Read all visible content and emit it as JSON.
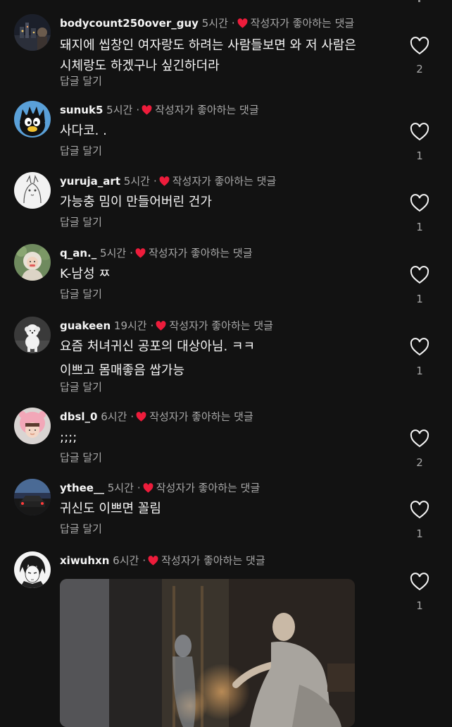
{
  "labels": {
    "liked_by_author": "작성자가 좋아하는 댓글",
    "reply": "답글 달기",
    "separator": "·"
  },
  "colors": {
    "background": "#121212",
    "heart_red": "#ed1c3b",
    "muted_text": "#a8a8a8"
  },
  "comments": [
    {
      "username": "bodycount250over_guy",
      "time": "5시간",
      "text": "돼지에 씹창인 여자랑도 하려는 사람들보면 와 저 사람은 시체랑도 하겠구나 싶긴하더라",
      "likes": "2",
      "avatar": "night-city-avatar"
    },
    {
      "username": "sunuk5",
      "time": "5시간",
      "text": "사다코. .",
      "likes": "1",
      "avatar": "badtz-maru-avatar"
    },
    {
      "username": "yuruja_art",
      "time": "5시간",
      "text": "가능충 밈이 만들어버린 건가",
      "likes": "1",
      "avatar": "sketch-avatar"
    },
    {
      "username": "q_an._",
      "time": "5시간",
      "text": "K-남성 ㅉ",
      "likes": "1",
      "avatar": "hooded-figure-avatar"
    },
    {
      "username": "guakeen",
      "time": "19시간",
      "text_lines": [
        "요즘 처녀귀신 공포의 대상아님. ㅋㅋ",
        "이쁘고 몸매좋음 쌉가능"
      ],
      "likes": "1",
      "avatar": "white-dog-avatar"
    },
    {
      "username": "dbsl_0",
      "time": "6시간",
      "text": ";;;;",
      "likes": "2",
      "avatar": "pink-hat-avatar"
    },
    {
      "username": "ythee__",
      "time": "5시간",
      "text": "귀신도 이쁘면 꼴림",
      "likes": "1",
      "avatar": "car-night-avatar"
    },
    {
      "username": "xiwuhxn",
      "time": "6시간",
      "likes": "1",
      "avatar": "anime-sketch-avatar",
      "attachment": "gif-image"
    }
  ]
}
